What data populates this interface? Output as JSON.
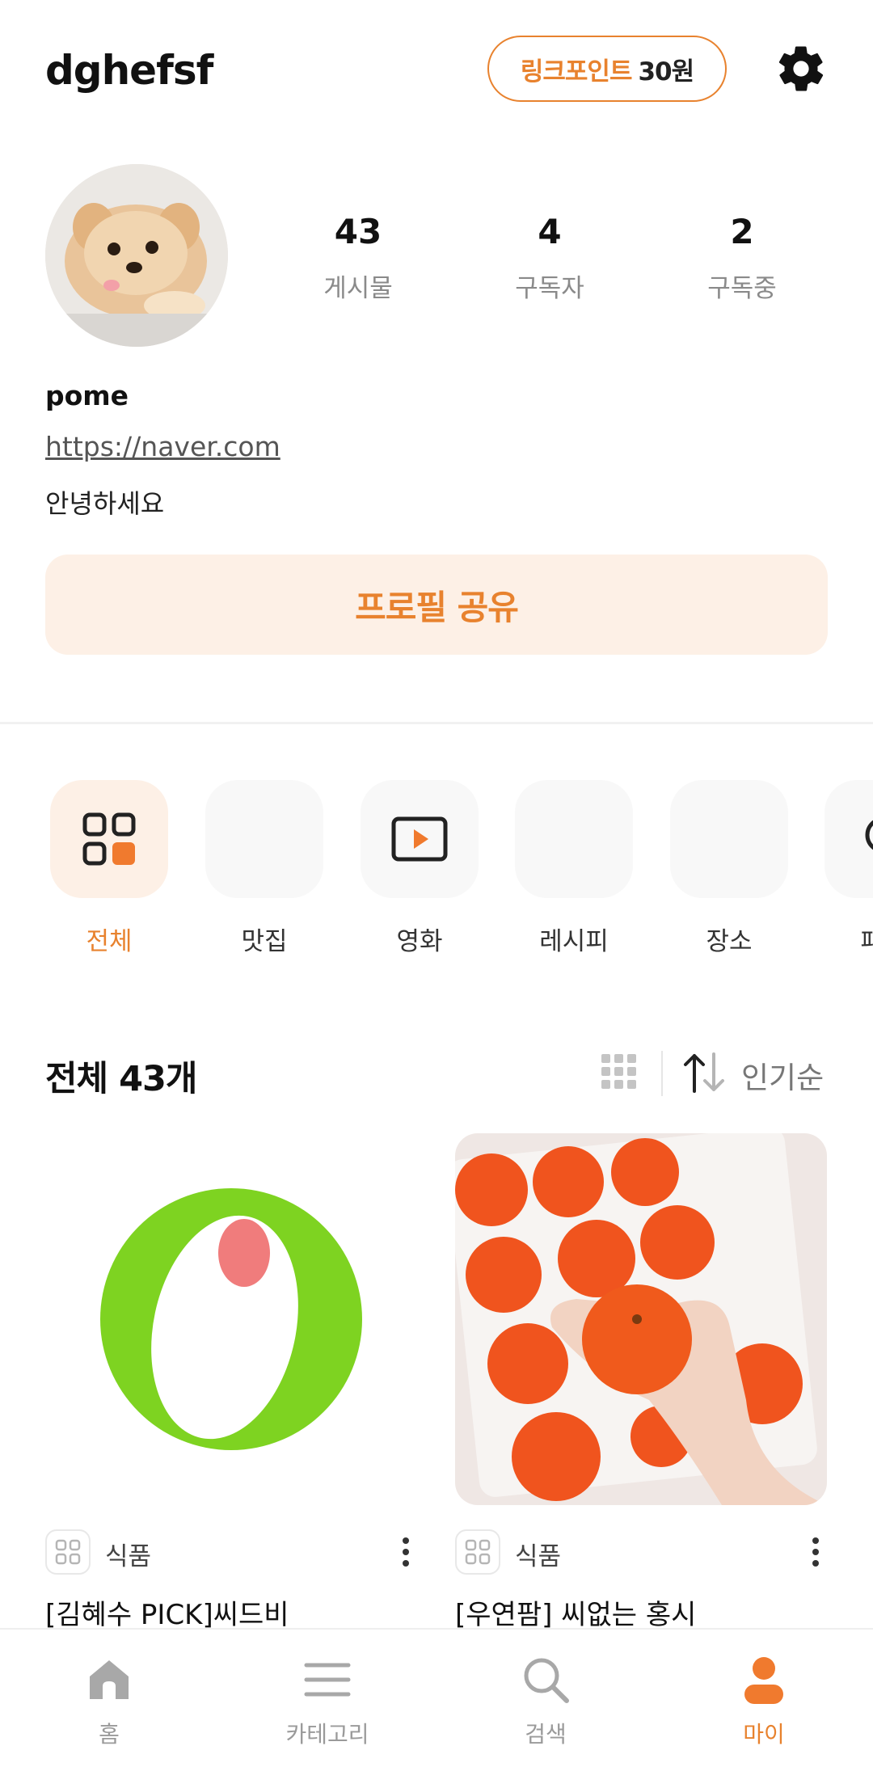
{
  "header": {
    "username": "dghefsf",
    "points_label": "링크포인트",
    "points_amount": "30원"
  },
  "profile": {
    "stats": [
      {
        "value": "43",
        "label": "게시물"
      },
      {
        "value": "4",
        "label": "구독자"
      },
      {
        "value": "2",
        "label": "구독중"
      }
    ],
    "nickname": "pome",
    "link": "https://naver.com",
    "bio": "안녕하세요",
    "share_button": "프로필 공유"
  },
  "categories": [
    {
      "label": "전체",
      "icon": "grid-icon",
      "active": true
    },
    {
      "label": "맛집",
      "icon": "",
      "active": false
    },
    {
      "label": "영화",
      "icon": "play-icon",
      "active": false
    },
    {
      "label": "레시피",
      "icon": "",
      "active": false
    },
    {
      "label": "장소",
      "icon": "",
      "active": false
    },
    {
      "label": "패션",
      "icon": "pin-icon",
      "active": false
    }
  ],
  "list": {
    "title": "전체 43개",
    "sort_label": "인기순"
  },
  "posts": [
    {
      "category": "식품",
      "title": "[김혜수 PICK]씨드비"
    },
    {
      "category": "식품",
      "title": "[우연팜] 씨없는 홍시"
    }
  ],
  "bottom_nav": [
    {
      "label": "홈",
      "icon": "home-icon"
    },
    {
      "label": "카테고리",
      "icon": "menu-icon"
    },
    {
      "label": "검색",
      "icon": "search-icon"
    },
    {
      "label": "마이",
      "icon": "person-icon"
    }
  ],
  "colors": {
    "accent": "#e8822e",
    "accent_soft": "#fdf0e6",
    "muted": "#8a8a8a"
  }
}
